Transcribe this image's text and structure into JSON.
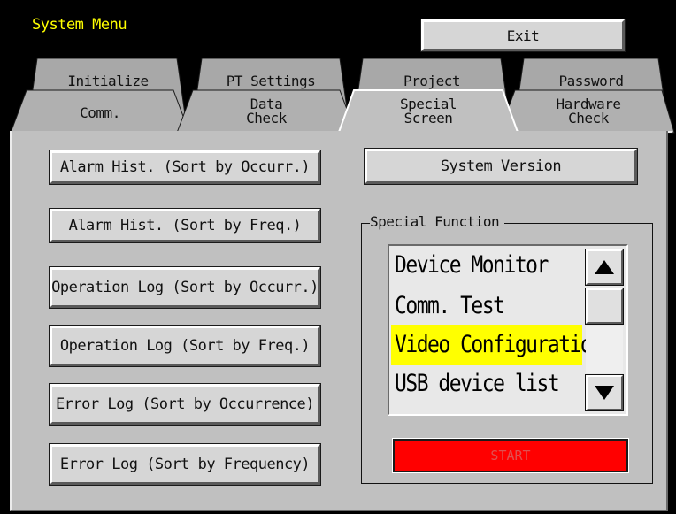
{
  "header": {
    "title": "System Menu",
    "exit_label": "Exit"
  },
  "tabs_back": [
    {
      "label": "Initialize"
    },
    {
      "label": "PT Settings"
    },
    {
      "label": "Project"
    },
    {
      "label": "Password"
    }
  ],
  "tabs_front": [
    {
      "label": "Comm."
    },
    {
      "label_line1": "Data",
      "label_line2": "Check"
    },
    {
      "label_line1": "Special",
      "label_line2": "Screen",
      "active": true
    },
    {
      "label_line1": "Hardware",
      "label_line2": "Check"
    }
  ],
  "left_buttons": [
    "Alarm Hist. (Sort by Occurr.)",
    "Alarm Hist. (Sort by Freq.)",
    "Operation Log (Sort by Occurr.)",
    "Operation Log (Sort by Freq.)",
    "Error Log (Sort by Occurrence)",
    "Error Log (Sort by Frequency)"
  ],
  "system_version_label": "System Version",
  "special_function": {
    "group_label": "Special Function",
    "items": [
      "Device Monitor",
      "Comm. Test",
      "Video Configuration",
      "USB device list"
    ],
    "selected_index": 2,
    "start_label": "START"
  },
  "colors": {
    "title": "#ffff00",
    "highlight": "#ffff00",
    "start_button": "#ff0000",
    "panel": "#c0c0c0"
  },
  "icons": {
    "scroll_up": "triangle-up-icon",
    "scroll_down": "triangle-down-icon"
  }
}
